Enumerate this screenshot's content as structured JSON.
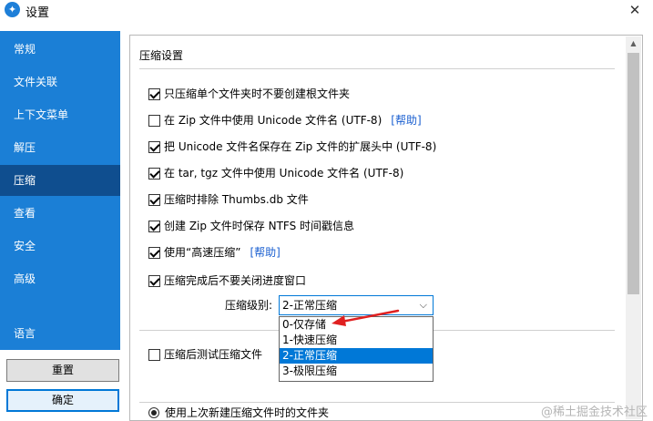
{
  "window": {
    "title": "设置",
    "close_glyph": "✕",
    "icon": "app-logo-icon"
  },
  "sidebar": {
    "items": [
      {
        "label": "常规"
      },
      {
        "label": "文件关联"
      },
      {
        "label": "上下文菜单"
      },
      {
        "label": "解压"
      },
      {
        "label": "压缩",
        "active": true
      },
      {
        "label": "查看"
      },
      {
        "label": "安全"
      },
      {
        "label": "高级"
      },
      {
        "label": "语言"
      }
    ],
    "reset_button": "重置",
    "ok_button": "确定"
  },
  "panel": {
    "title": "压缩设置",
    "options": [
      {
        "label": "只压缩单个文件夹时不要创建根文件夹",
        "checked": true
      },
      {
        "label": "在 Zip 文件中使用 Unicode 文件名 (UTF-8)",
        "checked": false,
        "link": "[帮助]"
      },
      {
        "label": "把 Unicode 文件名保存在 Zip 文件的扩展头中 (UTF-8)",
        "checked": true
      },
      {
        "label": "在 tar, tgz 文件中使用 Unicode 文件名 (UTF-8)",
        "checked": true
      },
      {
        "label": "压缩时排除 Thumbs.db 文件",
        "checked": true
      },
      {
        "label": "创建 Zip 文件时保存 NTFS 时间戳信息",
        "checked": true
      },
      {
        "label": "使用“高速压缩”",
        "checked": true,
        "link": "[帮助]"
      },
      {
        "label": "压缩完成后不要关闭进度窗口",
        "checked": true
      }
    ],
    "level_label": "压缩级别:",
    "level_value": "2-正常压缩",
    "level_options": [
      "0-仅存储",
      "1-快速压缩",
      "2-正常压缩",
      "3-极限压缩"
    ],
    "level_selected_index": 2,
    "test_option": {
      "label": "压缩后测试压缩文件",
      "checked": false
    },
    "radio_option": {
      "label": "使用上次新建压缩文件时的文件夹",
      "selected": true
    }
  },
  "watermark": "@稀土掘金技术社区",
  "colors": {
    "sidebar": "#1b7fd6",
    "sidebar_active": "#0f4e8f",
    "selection": "#0078d7",
    "arrow": "#e02020",
    "link": "#1a5fd0"
  }
}
